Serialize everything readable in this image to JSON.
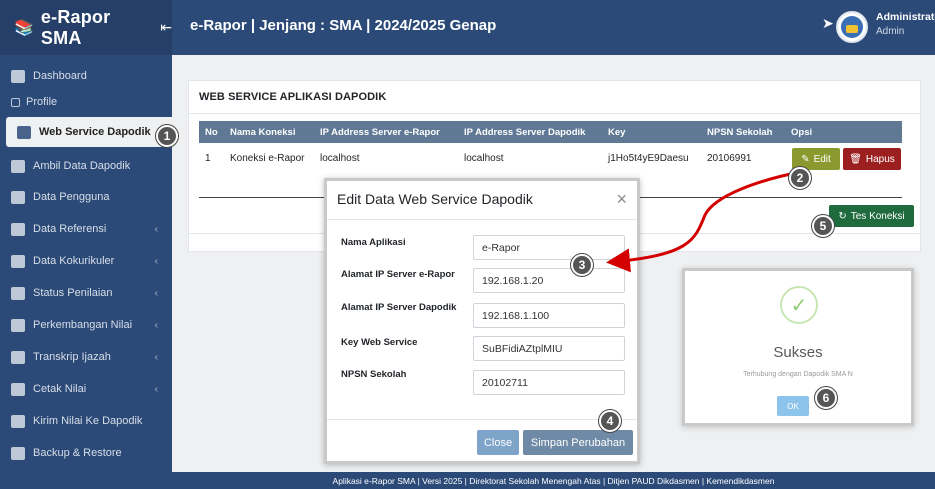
{
  "topbar": {
    "app_name": "e-Rapor SMA",
    "page_title": "e-Rapor | Jenjang : SMA | 2024/2025 Genap",
    "user_name": "Administrator",
    "user_role": "Admin"
  },
  "sidebar": {
    "items": [
      {
        "label": "Dashboard"
      },
      {
        "label": "Profile"
      },
      {
        "label": "Web Service Dapodik"
      },
      {
        "label": "Ambil Data Dapodik"
      },
      {
        "label": "Data Pengguna"
      },
      {
        "label": "Data Referensi"
      },
      {
        "label": "Data Kokurikuler"
      },
      {
        "label": "Status Penilaian"
      },
      {
        "label": "Perkembangan Nilai"
      },
      {
        "label": "Transkrip Ijazah"
      },
      {
        "label": "Cetak Nilai"
      },
      {
        "label": "Kirim Nilai Ke Dapodik"
      },
      {
        "label": "Backup & Restore"
      }
    ]
  },
  "card": {
    "title": "WEB SERVICE APLIKASI DAPODIK",
    "headers": [
      "No",
      "Nama Koneksi",
      "IP Address Server e-Rapor",
      "IP Address Server Dapodik",
      "Key",
      "NPSN Sekolah",
      "Opsi"
    ],
    "row": {
      "no": "1",
      "nama": "Koneksi e-Rapor",
      "ip_rapor": "localhost",
      "ip_dapodik": "localhost",
      "key": "j1Ho5t4yE9Daesu",
      "npsn": "20106991"
    },
    "edit_label": "Edit",
    "hapus_label": "Hapus",
    "tes_label": "Tes Koneksi"
  },
  "modal": {
    "title": "Edit Data Web Service Dapodik",
    "fields": [
      {
        "label": "Nama Aplikasi",
        "value": "e-Rapor"
      },
      {
        "label": "Alamat IP Server e-Rapor",
        "value": "192.168.1.20"
      },
      {
        "label": "Alamat IP Server Dapodik",
        "value": "192.168.1.100"
      },
      {
        "label": "Key Web Service",
        "value": "SuBFidiAZtplMIU"
      },
      {
        "label": "NPSN Sekolah",
        "value": "20102711"
      }
    ],
    "close_label": "Close",
    "save_label": "Simpan Perubahan"
  },
  "success": {
    "title": "Sukses",
    "text": "Terhubung dengan Dapodik SMA N",
    "ok_label": "OK"
  },
  "footer": {
    "text": "Aplikasi e-Rapor SMA | Versi 2025 | Direktorat Sekolah Menengah Atas | Ditjen PAUD Dikdasmen | Kemendikdasmen"
  },
  "markers": [
    "1",
    "2",
    "3",
    "4",
    "5",
    "6"
  ],
  "colors": {
    "topbar": "#2b4a78",
    "table_header": "#5f7995",
    "edit": "#8a9a2e",
    "hapus": "#9c1f1f",
    "tes": "#1f6b3e",
    "arrow": "#d40000"
  }
}
